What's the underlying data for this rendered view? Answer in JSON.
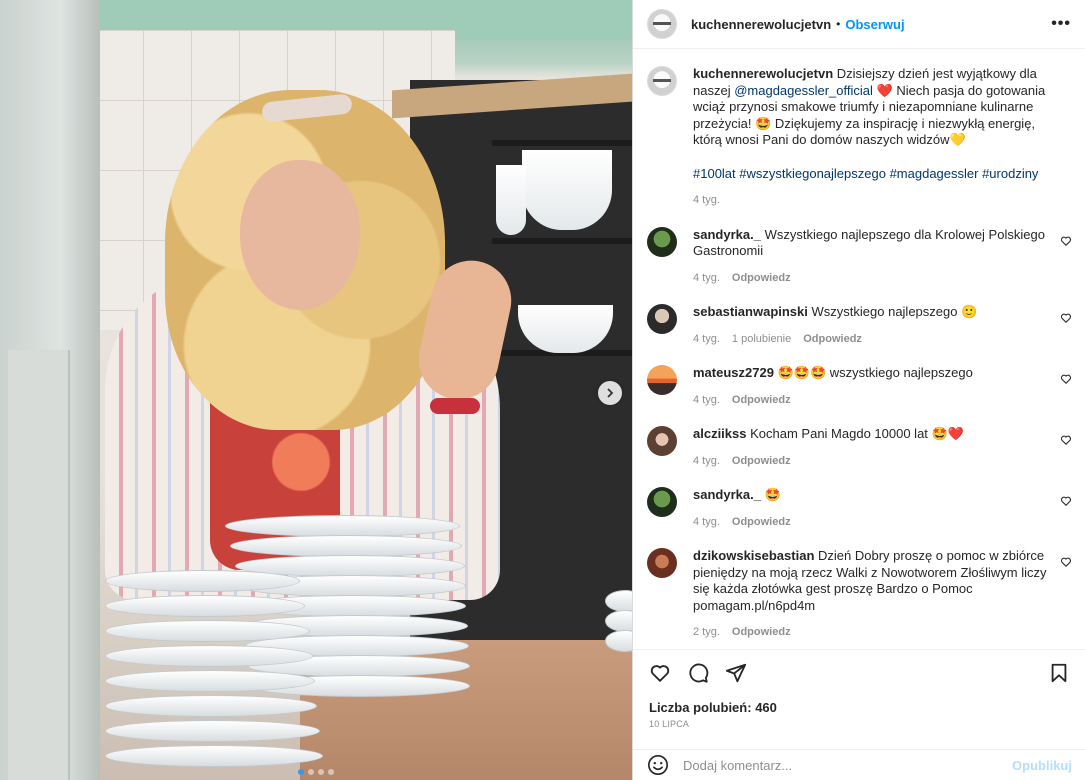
{
  "post": {
    "username": "kuchennerewolucjetvn",
    "follow_label": "Obserwuj",
    "separator": "•",
    "more_label": "•••"
  },
  "caption": {
    "username": "kuchennerewolucjetvn",
    "text_1": "Dzisiejszy dzień jest wyjątkowy dla naszej",
    "mention": "@magdagessler_official",
    "text_2": "❤️ Niech pasja do gotowania wciąż przynosi smakowe triumfy i niezapomniane kulinarne przeżycia! 🤩 Dziękujemy za inspirację i niezwykłą energię, którą wnosi Pani do domów naszych widzów💛",
    "hashtags": "#100lat #wszystkiegonajlepszego #magdagessler #urodziny",
    "time": "4 tyg."
  },
  "comments": [
    {
      "username": "sandyrka._",
      "text": "Wszystkiego najlepszego dla Krolowej Polskiego Gastronomii",
      "time": "4 tyg.",
      "likes": "",
      "reply": "Odpowiedz"
    },
    {
      "username": "sebastianwapinski",
      "text": "Wszystkiego najlepszego 🙂",
      "time": "4 tyg.",
      "likes": "1 polubienie",
      "reply": "Odpowiedz"
    },
    {
      "username": "mateusz2729",
      "text": "🤩🤩🤩 wszystkiego najlepszego",
      "time": "4 tyg.",
      "likes": "",
      "reply": "Odpowiedz"
    },
    {
      "username": "alcziikss",
      "text": "Kocham Pani Magdo 10000 lat 🤩❤️",
      "time": "4 tyg.",
      "likes": "",
      "reply": "Odpowiedz"
    },
    {
      "username": "sandyrka._",
      "text": "🤩",
      "time": "4 tyg.",
      "likes": "",
      "reply": "Odpowiedz"
    },
    {
      "username": "dzikowskisebastian",
      "text": "Dzień Dobry proszę o pomoc w zbiórce pieniędzy na moją rzecz Walki z Nowotworem Złośliwym liczy się każda złotówka gest proszę Bardzo o Pomoc pomagam.pl/n6pd4m",
      "time": "2 tyg.",
      "likes": "",
      "reply": "Odpowiedz"
    }
  ],
  "stats": {
    "likes_label": "Liczba polubień:",
    "likes_count": "460",
    "date": "10 LIPCA"
  },
  "composer": {
    "placeholder": "Dodaj komentarz...",
    "post_label": "Opublikuj"
  },
  "carousel": {
    "slide_count": 4,
    "active_slide": 1
  },
  "colors": {
    "accent": "#0095f6",
    "link": "#00376b",
    "muted": "#8e8e8e"
  },
  "icons": [
    "chevron-right-icon",
    "heart-icon",
    "comment-icon",
    "share-icon",
    "bookmark-icon",
    "emoji-icon",
    "more-icon"
  ]
}
